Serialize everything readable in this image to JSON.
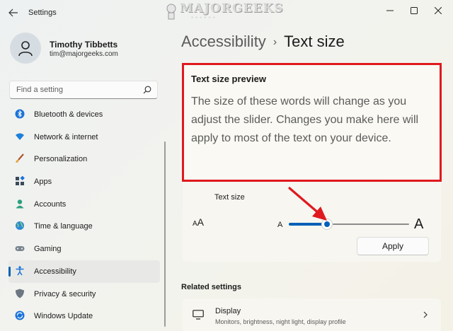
{
  "window": {
    "title": "Settings",
    "watermark": "MAJORGEEKS",
    "watermark_stars": "******"
  },
  "profile": {
    "name": "Timothy Tibbetts",
    "email": "tim@majorgeeks.com"
  },
  "search": {
    "placeholder": "Find a setting"
  },
  "sidebar": {
    "items": [
      {
        "label": "Bluetooth & devices",
        "icon": "bluetooth-icon",
        "active": false
      },
      {
        "label": "Network & internet",
        "icon": "wifi-icon",
        "active": false
      },
      {
        "label": "Personalization",
        "icon": "brush-icon",
        "active": false
      },
      {
        "label": "Apps",
        "icon": "apps-icon",
        "active": false
      },
      {
        "label": "Accounts",
        "icon": "person-icon",
        "active": false
      },
      {
        "label": "Time & language",
        "icon": "globe-icon",
        "active": false
      },
      {
        "label": "Gaming",
        "icon": "gamepad-icon",
        "active": false
      },
      {
        "label": "Accessibility",
        "icon": "accessibility-icon",
        "active": true
      },
      {
        "label": "Privacy & security",
        "icon": "shield-icon",
        "active": false
      },
      {
        "label": "Windows Update",
        "icon": "update-icon",
        "active": false
      }
    ]
  },
  "breadcrumb": {
    "parent": "Accessibility",
    "separator": "›",
    "current": "Text size"
  },
  "preview": {
    "title": "Text size preview",
    "body": "The size of these words will change as you adjust the slider. Changes you make here will apply to most of the text on your device."
  },
  "text_size": {
    "label": "Text size",
    "icon_text_large": "A",
    "icon_text_small": "A",
    "min_label": "A",
    "max_label": "A",
    "slider_fraction": 0.32,
    "apply_label": "Apply"
  },
  "related": {
    "heading": "Related settings",
    "display": {
      "title": "Display",
      "subtitle": "Monitors, brightness, night light, display profile"
    }
  },
  "colors": {
    "accent": "#005fb8",
    "highlight": "#e0191e"
  }
}
